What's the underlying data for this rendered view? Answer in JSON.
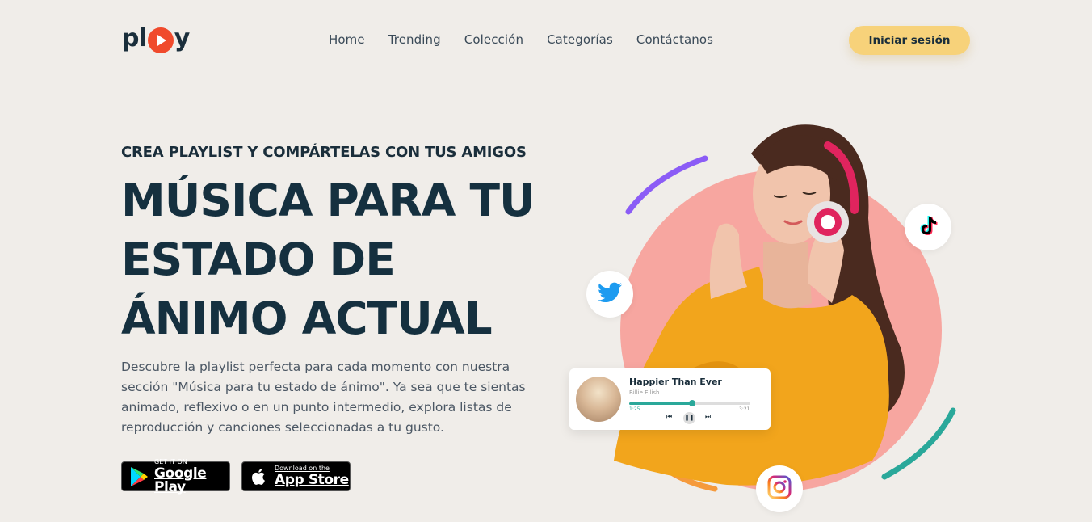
{
  "header": {
    "logo_left": "pl",
    "logo_right": "y",
    "nav": [
      "Home",
      "Trending",
      "Colección",
      "Categorías",
      "Contáctanos"
    ],
    "login_label": "Iniciar sesión"
  },
  "hero": {
    "kicker": "CREA PLAYLIST Y COMPÁRTELAS CON TUS AMIGOS",
    "headline_lines": [
      "MÚSICA PARA TU",
      "ESTADO DE",
      "ÁNIMO ACTUAL"
    ],
    "description": "Descubre la playlist perfecta para cada momento con nuestra sección \"Música para tu estado de ánimo\". Ya sea que te sientas animado, reflexivo o en un punto intermedio, explora listas de reproducción y canciones seleccionadas a tu gusto.",
    "google_play": {
      "small": "GET IT ON",
      "big": "Google Play"
    },
    "app_store": {
      "small": "Download on the",
      "big": "App Store"
    }
  },
  "player": {
    "song": "Happier Than Ever",
    "artist": "Billie Eilish",
    "elapsed": "1:25",
    "duration": "3:21",
    "progress_fraction": 0.52
  },
  "colors": {
    "background": "#f0ede9",
    "accent": "#f04a2c",
    "button": "#f7d27a",
    "circle": "#f7a6a0",
    "teal": "#2aa89a",
    "purple": "#8b5cf6",
    "orange": "#f59a3c"
  },
  "icons": [
    "twitter-icon",
    "tiktok-icon",
    "instagram-icon",
    "google-play-icon",
    "apple-icon"
  ]
}
